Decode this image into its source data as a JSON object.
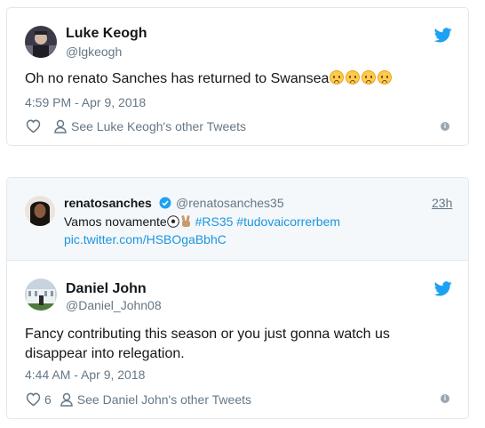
{
  "tweet1": {
    "author_name": "Luke Keogh",
    "author_handle": "@lgkeogh",
    "text": "Oh no renato Sanches has returned to Swansea",
    "emoji_count": 4,
    "timestamp": "4:59 PM - Apr 9, 2018",
    "see_other": "See Luke Keogh's other Tweets"
  },
  "tweet2": {
    "quoted": {
      "author_name": "renatosanches",
      "author_handle": "@renatosanches35",
      "age": "23h",
      "text_prefix": "Vamos novamente",
      "hashtags": "#RS35 #tudovaicorrerbem",
      "link": "pic.twitter.com/HSBOgaBbhC"
    },
    "author_name": "Daniel John",
    "author_handle": "@Daniel_John08",
    "text": "Fancy contributing this season or you just gonna watch us disappear into relegation.",
    "timestamp": "4:44 AM - Apr 9, 2018",
    "like_count": "6",
    "see_other": "See Daniel John's other Tweets"
  },
  "colors": {
    "accent": "#1da1f2",
    "link": "#1b95e0",
    "muted": "#657786",
    "border": "#e1e8ed"
  },
  "icons": [
    "twitter-bird-icon",
    "heart-icon",
    "person-icon",
    "info-icon",
    "verified-icon",
    "soccer-ball-icon",
    "victory-hand-icon",
    "worried-face-icon"
  ]
}
